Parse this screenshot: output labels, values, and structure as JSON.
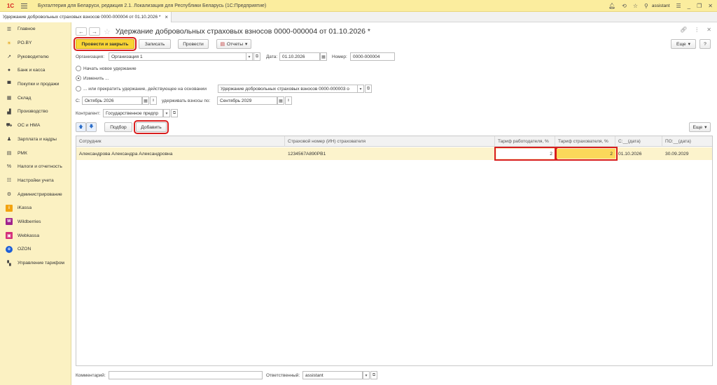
{
  "titlebar": {
    "logo": "1С",
    "title": "Бухгалтерия для Беларуси, редакция 2.1. Локализация для Республики Беларусь   (1С:Предприятие)",
    "user": "assistant"
  },
  "tabs": [
    {
      "label": "Удержание добровольных страховых взносов 0000-000004 от 01.10.2026 *"
    }
  ],
  "sidebar": {
    "items": [
      {
        "label": "Главное",
        "icon": "menu-icon"
      },
      {
        "label": "PO.BY",
        "icon": "sun-icon"
      },
      {
        "label": "Руководителю",
        "icon": "trend-icon"
      },
      {
        "label": "Банк и касса",
        "icon": "coin-icon"
      },
      {
        "label": "Покупки и продажи",
        "icon": "cart-icon"
      },
      {
        "label": "Склад",
        "icon": "warehouse-icon"
      },
      {
        "label": "Производство",
        "icon": "factory-icon"
      },
      {
        "label": "ОС и НМА",
        "icon": "truck-icon"
      },
      {
        "label": "Зарплата и кадры",
        "icon": "person-icon"
      },
      {
        "label": "РМК",
        "icon": "register-icon"
      },
      {
        "label": "Налоги и отчетность",
        "icon": "percent-icon"
      },
      {
        "label": "Настройки учета",
        "icon": "sliders-icon"
      },
      {
        "label": "Администрирование",
        "icon": "gear-icon"
      },
      {
        "label": "iKassa",
        "icon": "ikassa-icon"
      },
      {
        "label": "Wildberries",
        "icon": "wildberries-icon"
      },
      {
        "label": "Webkassa",
        "icon": "webkassa-icon"
      },
      {
        "label": "OZON",
        "icon": "ozon-icon"
      },
      {
        "label": "Управление тарифом",
        "icon": "tariff-icon"
      }
    ]
  },
  "doc": {
    "title": "Удержание добровольных страховых взносов 0000-000004 от 01.10.2026 *"
  },
  "toolbar": {
    "post_close": "Провести и закрыть",
    "save": "Записать",
    "post": "Провести",
    "reports": "Отчеты",
    "more": "Еще",
    "help": "?"
  },
  "form": {
    "org_label": "Организация:",
    "org_value": "Организация 1",
    "date_label": "Дата:",
    "date_value": "01.10.2026",
    "number_label": "Номер:",
    "number_value": "0000-000004",
    "radio_new": "Начать новое удержание",
    "radio_change": "Изменить ...",
    "radio_stop": "... или прекратить удержание, действующее на основании",
    "basis_value": "Удержание добровольных страховых взносов 0000-000003 о",
    "from_label": "С:",
    "from_value": "Октябрь 2026",
    "until_label": "удерживать взносы по:",
    "until_value": "Сентябрь 2029",
    "contractor_label": "Контрагент:",
    "contractor_value": "Государственное предпр"
  },
  "table_toolbar": {
    "select": "Подбор",
    "add": "Добавить",
    "more": "Еще"
  },
  "table": {
    "columns": [
      "Сотрудник",
      "Страховой номер (ИН) страхователя",
      "Тариф работодателя, %",
      "Тариф страхователя, %",
      "С:__(дата)",
      "ПО:__(дата)"
    ],
    "rows": [
      [
        "Александрова Александра Александровна",
        "1234567А890РВ1",
        "2",
        "2",
        "01.10.2026",
        "30.09.2029"
      ]
    ]
  },
  "footer": {
    "comment_label": "Комментарий:",
    "comment_value": "",
    "responsible_label": "Ответственный:",
    "responsible_value": "assistant"
  }
}
